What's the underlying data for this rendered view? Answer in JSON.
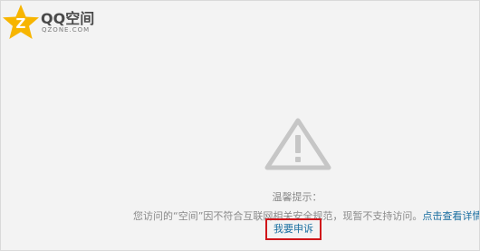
{
  "brand": {
    "title": "QQ空间",
    "subtitle": "QZONE.COM",
    "icon": "qzone-star-icon",
    "colors": {
      "star": "#f7b500",
      "text": "#4a4a4a"
    }
  },
  "notice": {
    "icon": "warning-triangle-icon",
    "title": "温馨提示：",
    "message": "您访问的“空间”因不符合互联网相关安全规范，现暂不支持访问。",
    "detail_link": "点击查看详情",
    "appeal_link": "我要申诉"
  },
  "colors": {
    "background": "#f3f3f3",
    "text": "#8a8a8a",
    "link": "#1a6ea0",
    "highlight": "#d0161b",
    "icon": "#c6c6c6"
  }
}
